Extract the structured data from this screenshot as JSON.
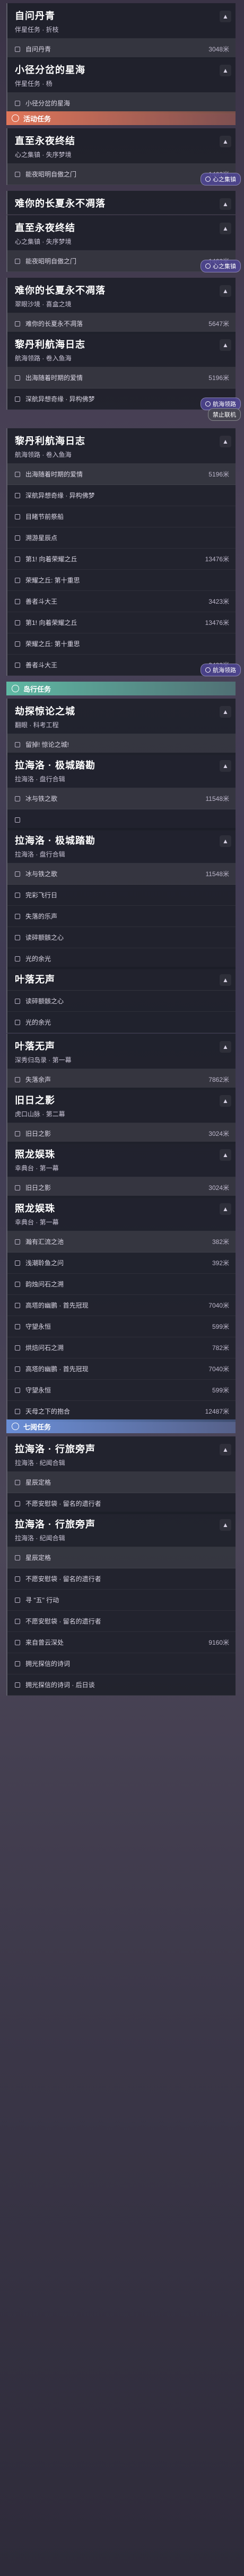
{
  "panels": [
    {
      "title": "自问丹青",
      "subtitle": "伴星任务 · 折枝",
      "rows": [
        {
          "label": "自问丹青",
          "value": "3048米",
          "current": true
        }
      ]
    },
    {
      "title": "小径分岔的星海",
      "subtitle": "伴星任务 · 杨",
      "rows": [
        {
          "label": "小径分岔的星海",
          "value": "",
          "current": true
        }
      ]
    }
  ],
  "sections": {
    "activity": "活动任务",
    "island": "岛行任务",
    "seven": "七阅任务"
  },
  "activity_panels": [
    {
      "title": "直至永夜终结",
      "subtitle": "心之集镇 · 失序梦境",
      "rows": [
        {
          "label": "能夜昭明自傲之门",
          "value": "1462米",
          "current": true
        }
      ],
      "tag": "心之集镇"
    },
    {
      "title": "难你的长夏永不凋落",
      "subtitle": "",
      "rows": [],
      "tag": ""
    },
    {
      "title": "直至永夜终结",
      "subtitle": "心之集镇 · 失序梦境",
      "rows": [
        {
          "label": "能夜昭明自傲之门",
          "value": "1462米",
          "current": true
        }
      ],
      "tag": "心之集镇"
    },
    {
      "title": "难你的长夏永不凋落",
      "subtitle": "翠眼沙境 · 喜盒之境",
      "rows": [
        {
          "label": "难你的长夏永不凋落",
          "value": "5647米",
          "current": true
        }
      ],
      "tag": ""
    },
    {
      "title": "黎丹利航海日志",
      "subtitle": "航海领路 · 卷入鱼海",
      "rows": [
        {
          "label": "出海随着时期的爱情",
          "value": "5196米",
          "current": true
        },
        {
          "label": "深航异想奇缘 · 异构佛梦",
          "value": "",
          "current": false
        }
      ],
      "tag": "航海领路",
      "tag2": "禁止联机"
    },
    {
      "title": "黎丹利航海日志",
      "subtitle": "航海领路 · 卷入鱼海",
      "rows": [
        {
          "label": "出海随着时期的爱情",
          "value": "5196米",
          "current": true
        },
        {
          "label": "深航异想奇缘 · 异构佛梦",
          "value": "",
          "current": false
        },
        {
          "label": "目睹节前祭船",
          "value": "",
          "current": false
        },
        {
          "label": "溯游星辰点",
          "value": "",
          "current": false
        },
        {
          "label": "第1! 向着荣耀之丘",
          "value": "13476米",
          "current": false
        },
        {
          "label": "荣耀之丘: 第十重思",
          "value": "",
          "current": false
        },
        {
          "label": "善者斗大王",
          "value": "3423米",
          "current": false
        },
        {
          "label": "第1! 向着荣耀之丘",
          "value": "13476米",
          "current": false
        },
        {
          "label": "荣耀之丘: 第十重思",
          "value": "",
          "current": false
        },
        {
          "label": "善者斗大王",
          "value": "3423米",
          "current": false
        }
      ],
      "tag": "航海领路"
    }
  ],
  "island_panels": [
    {
      "title": "劫探惊论之城",
      "subtitle": "翻眼 · 科考工程",
      "rows": [
        {
          "label": "留掉! 惊论之城!",
          "value": "",
          "current": true
        }
      ]
    },
    {
      "title": "拉海洛 · 极城踏勘",
      "subtitle": "拉海洛 · 盘行合辑",
      "rows": [
        {
          "label": "冰与铁之歌",
          "value": "11548米",
          "current": true
        },
        {
          "label": "",
          "value": "",
          "current": false
        }
      ]
    },
    {
      "title": "拉海洛 · 极城踏勘",
      "subtitle": "拉海洛 · 盘行合辑",
      "rows": [
        {
          "label": "冰与铁之歌",
          "value": "11548米",
          "current": true
        },
        {
          "label": "完彩飞行日",
          "value": "",
          "current": false
        },
        {
          "label": "失落的乐声",
          "value": "",
          "current": false
        },
        {
          "label": "读碎额骸之心",
          "value": "",
          "current": false
        },
        {
          "label": "光的余光",
          "value": "",
          "current": false
        }
      ]
    },
    {
      "title": "叶落无声",
      "subtitle": "",
      "rows": [
        {
          "label": "读碎额骸之心",
          "value": "",
          "current": false
        },
        {
          "label": "光的余光",
          "value": "",
          "current": false
        }
      ]
    },
    {
      "title": "叶落无声",
      "subtitle": "深秀归岛录 · 第一幕",
      "rows": [
        {
          "label": "失落余声",
          "value": "7862米",
          "current": true
        }
      ]
    },
    {
      "title": "旧日之影",
      "subtitle": "虎口山脉 · 第二幕",
      "rows": [
        {
          "label": "旧日之影",
          "value": "3024米",
          "current": true
        }
      ]
    },
    {
      "title": "照龙娱珠",
      "subtitle": "幸典台 · 第一幕",
      "rows": [
        {
          "label": "旧日之影",
          "value": "3024米",
          "current": true
        }
      ]
    },
    {
      "title": "照龙娱珠",
      "subtitle": "幸典台 · 第一幕",
      "rows": [
        {
          "label": "瀚有汇流之池",
          "value": "382米",
          "current": true
        },
        {
          "label": "浅潮聆鱼之问",
          "value": "392米",
          "current": false
        },
        {
          "label": "韵烛问石之溯",
          "value": "",
          "current": false
        },
        {
          "label": "高塔的幽鹏 · 首先冠现",
          "value": "7040米",
          "current": false
        },
        {
          "label": "守望永恒",
          "value": "599米",
          "current": false
        },
        {
          "label": "烘焙问石之溯",
          "value": "782米",
          "current": false
        },
        {
          "label": "高塔的幽鹏 · 首先冠现",
          "value": "7040米",
          "current": false
        },
        {
          "label": "守望永恒",
          "value": "599米",
          "current": false
        },
        {
          "label": "天母之下的抱合",
          "value": "12487米",
          "current": false
        }
      ]
    }
  ],
  "seven_panels": [
    {
      "title": "拉海洛 · 行旅旁声",
      "subtitle": "拉海洛 · 纪闻合辑",
      "rows": [
        {
          "label": "星辰定格",
          "value": "",
          "current": true
        },
        {
          "label": "不愿安慰袋 · 留名的遗行者",
          "value": "",
          "current": false
        }
      ]
    },
    {
      "title": "拉海洛 · 行旅旁声",
      "subtitle": "拉海洛 · 纪闻合辑",
      "rows": [
        {
          "label": "星辰定格",
          "value": "",
          "current": true
        },
        {
          "label": "不愿安慰袋 · 留名的遗行者",
          "value": "",
          "current": false
        },
        {
          "label": "寻 \"五\" 行动",
          "value": "",
          "current": false
        },
        {
          "label": "不愿安慰袋 · 留名的遗行者",
          "value": "",
          "current": false
        },
        {
          "label": "来自曾云深处",
          "value": "9160米",
          "current": false
        },
        {
          "label": "拥光探信的诗词",
          "value": "",
          "current": false
        },
        {
          "label": "拥光探信的诗词 · 后日谈",
          "value": "",
          "current": false
        }
      ]
    }
  ]
}
